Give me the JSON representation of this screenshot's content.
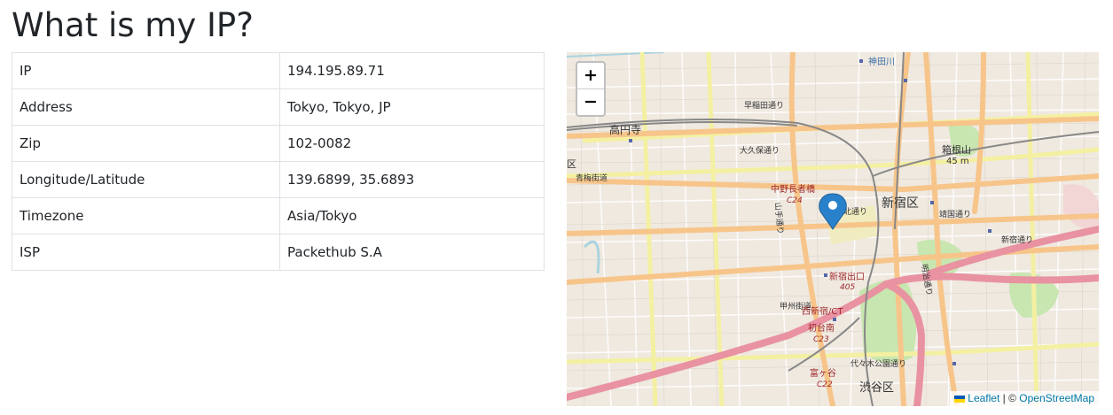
{
  "page": {
    "title": "What is my IP?"
  },
  "info_rows": [
    {
      "key": "IP",
      "value": "194.195.89.71"
    },
    {
      "key": "Address",
      "value": "Tokyo, Tokyo, JP"
    },
    {
      "key": "Zip",
      "value": "102-0082"
    },
    {
      "key": "Longitude/Latitude",
      "value": "139.6899, 35.6893"
    },
    {
      "key": "Timezone",
      "value": "Asia/Tokyo"
    },
    {
      "key": "ISP",
      "value": "Packethub S.A"
    }
  ],
  "map": {
    "zoom_in_label": "+",
    "zoom_out_label": "−",
    "marker_icon": "map-pin-icon",
    "attribution": {
      "leaflet_label": "Leaflet",
      "separator": " | © ",
      "osm_label": "OpenStreetMap"
    },
    "place_labels": {
      "takadanobaba": "高円寺",
      "shinjuku_ku": "新宿区",
      "shibuya_ku": "渋谷区",
      "nakano_chojabashi": "中野長者橋",
      "c24": "C24",
      "shinjuku_exit": "新宿出口",
      "r405": "405",
      "nishi_shinjuku": "西新宿/CT",
      "hatsudai": "初台南",
      "c23": "C23",
      "tomigaya": "富ヶ谷",
      "c22": "C22",
      "hakoneyama": "箱根山",
      "elev": "45 m",
      "ome_kaido": "青梅街道",
      "waseda_dori": "早稲田通り",
      "okubo_dori": "大久保通り",
      "yamate_dori": "山手通り",
      "koshu_kaido": "甲州街道",
      "meiji_dori": "明治通り",
      "kanda_river": "神田川",
      "ku": "区",
      "yasukuni": "靖国通り",
      "shinjuku_dori": "新宿通り",
      "yoyogi": "代々木公園通り",
      "hotel_text": "北通り"
    },
    "colors": {
      "land": "#efe9e0",
      "park": "#c8e6b0",
      "major_road": "#f7c58a",
      "expressway": "#e892a2",
      "minor_road": "#ffffff",
      "secondary_road": "#f4f0a2",
      "rail": "#888888",
      "water": "#aad3df",
      "marker": "#2a81cb"
    }
  }
}
